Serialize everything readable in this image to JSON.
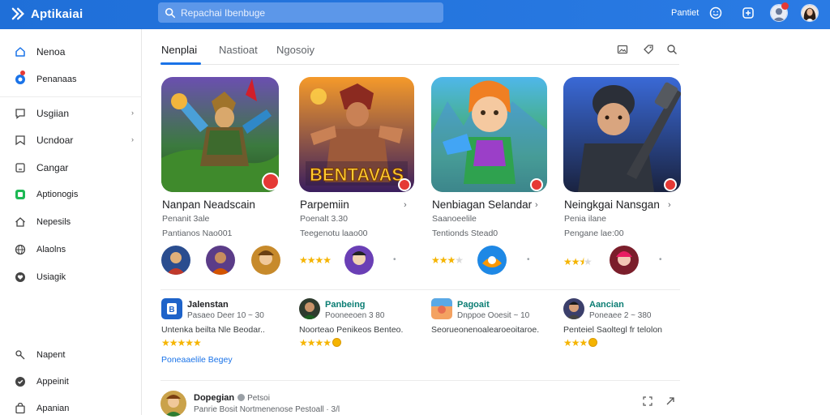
{
  "app": {
    "name": "Aptikaiai"
  },
  "search": {
    "placeholder": "Repachai Ibenbuge"
  },
  "header": {
    "link": "Pantiet"
  },
  "sidebar": {
    "items": [
      {
        "label": "Nenoa",
        "icon": "home-icon"
      },
      {
        "label": "Penanaas",
        "icon": "apps-icon"
      },
      {
        "label": "Usgiian",
        "icon": "chat-icon"
      },
      {
        "label": "Ucndoar",
        "icon": "bookmark-icon"
      },
      {
        "label": "Cangar",
        "icon": "square-icon"
      },
      {
        "label": "Aptionogis",
        "icon": "app-green-icon"
      },
      {
        "label": "Nepesils",
        "icon": "house-icon"
      },
      {
        "label": "Alaolns",
        "icon": "globe-icon"
      },
      {
        "label": "Usiagik",
        "icon": "heart-icon"
      },
      {
        "label": "Napent",
        "icon": "key-icon"
      },
      {
        "label": "Appeinit",
        "icon": "shield-icon"
      },
      {
        "label": "Apanian",
        "icon": "bag-icon"
      }
    ]
  },
  "tabs": [
    {
      "label": "Nenplai"
    },
    {
      "label": "Nastioat"
    },
    {
      "label": "Ngosoiy"
    }
  ],
  "cards": [
    {
      "title": "Nanpan Neadscain",
      "sub1": "Penanit 3ale",
      "sub2": "Pantianos Nao001",
      "rating": 0,
      "more": ""
    },
    {
      "title": "Parpemiin",
      "sub1": "Poenalt 3.30",
      "sub2": "Teegenotu laao00",
      "rating": 4,
      "more": "›"
    },
    {
      "title": "Nenbiagan Selandar",
      "sub1": "Saanoeelile",
      "sub2": "Tentionds Stead0",
      "rating": 3.5,
      "more": "›"
    },
    {
      "title": "Neingkgai Nansgan",
      "sub1": "Penia ilane",
      "sub2": "Pengane lae:00",
      "rating": 2.5,
      "more": "›"
    }
  ],
  "card3_logo_text": "BENTAVAS",
  "reviews": [
    {
      "name": "Jalenstan",
      "meta": "Pasaeo Deer 10 ~ 30",
      "text": "Untenka beilta Nle Beodar..",
      "rating": 5,
      "link": "Poneaaelile Begey"
    },
    {
      "name": "Panbeing",
      "meta": "Pooneeoen 3 80",
      "text": "Noorteao Penikeos Benteo.",
      "rating": 4,
      "link": ""
    },
    {
      "name": "Pagoait",
      "meta": "Dnppoe Ooesit ~ 10",
      "text": "Seorueonenoalearoeoitaroe.",
      "rating": 0,
      "link": ""
    },
    {
      "name": "Aancian",
      "meta": "Poneaee 2 ~ 380",
      "text": "Penteiel Saoltegl fr telolon",
      "rating": 3,
      "link": ""
    }
  ],
  "bottom": {
    "name": "Dopegian",
    "tag": "Petsoi",
    "meta": "Panrie Bosit Nortmenenose Pestoall · 3/l"
  },
  "colors": {
    "accent": "#1a73e8",
    "star": "#f5b400",
    "badge": "#e53935"
  }
}
